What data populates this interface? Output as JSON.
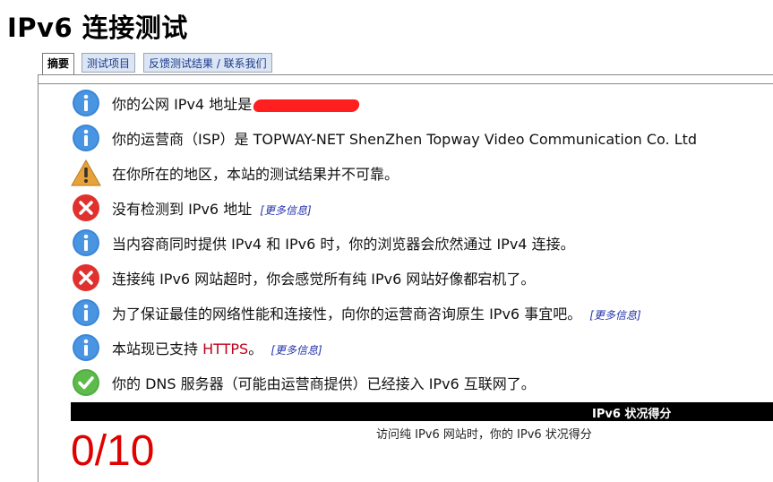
{
  "page_title": "IPv6 连接测试",
  "tabs": [
    {
      "label": "摘要",
      "active": true
    },
    {
      "label": "测试项目",
      "active": false
    },
    {
      "label": "反馈测试结果 / 联系我们",
      "active": false
    }
  ],
  "messages": [
    {
      "icon": "info-icon",
      "text": "你的公网 IPv4 地址是",
      "redacted": true
    },
    {
      "icon": "info-icon",
      "text": "你的运营商（ISP）是 TOPWAY-NET ShenZhen Topway Video Communication Co. Ltd"
    },
    {
      "icon": "warning-icon",
      "text": "在你所在的地区，本站的测试结果并不可靠。"
    },
    {
      "icon": "error-icon",
      "text": "没有检测到 IPv6 地址",
      "more": "[更多信息]"
    },
    {
      "icon": "info-icon",
      "text": "当内容商同时提供 IPv4 和 IPv6 时，你的浏览器会欣然通过 IPv4 连接。"
    },
    {
      "icon": "error-icon",
      "text": "连接纯 IPv6 网站超时，你会感觉所有纯 IPv6 网站好像都宕机了。"
    },
    {
      "icon": "info-icon",
      "text": "为了保证最佳的网络性能和连接性，向你的运营商咨询原生 IPv6 事宜吧。",
      "more": "[更多信息]"
    },
    {
      "icon": "info-icon",
      "text": "本站现已支持",
      "https": "HTTPS",
      "after": "。",
      "more": "[更多信息]"
    },
    {
      "icon": "ok-icon",
      "text": "你的 DNS 服务器（可能由运营商提供）已经接入 IPv6 互联网了。"
    }
  ],
  "score": {
    "header": "IPv6 状况得分",
    "value": "0/10",
    "description": "访问纯 IPv6 网站时，你的 IPv6 状况得分"
  },
  "colors": {
    "info": "#3b86d8",
    "warning": "#e8a23a",
    "error": "#e0312f",
    "ok": "#4fae3f",
    "score": "#e00000"
  }
}
